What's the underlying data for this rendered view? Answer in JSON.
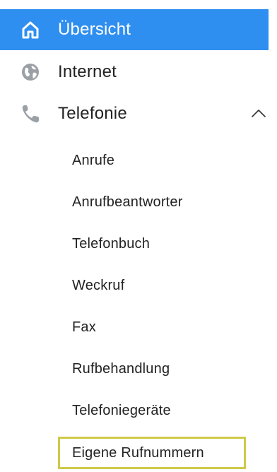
{
  "nav": {
    "items": [
      {
        "label": "Übersicht",
        "icon": "home-icon",
        "active": true
      },
      {
        "label": "Internet",
        "icon": "globe-icon"
      },
      {
        "label": "Telefonie",
        "icon": "phone-icon",
        "expanded": true,
        "toggle_icon": "chevron-up-icon"
      }
    ],
    "telefonie_subitems": [
      {
        "label": "Anrufe"
      },
      {
        "label": "Anrufbeantworter"
      },
      {
        "label": "Telefonbuch"
      },
      {
        "label": "Weckruf"
      },
      {
        "label": "Fax"
      },
      {
        "label": "Rufbehandlung"
      },
      {
        "label": "Telefoniegeräte"
      },
      {
        "label": "Eigene Rufnummern",
        "selected": true
      }
    ]
  },
  "colors": {
    "active_bg": "#2f8ff0",
    "active_text": "#ffffff",
    "text": "#222222",
    "icon_gray": "#9aa0a6",
    "selection_border": "#cfca4a"
  }
}
